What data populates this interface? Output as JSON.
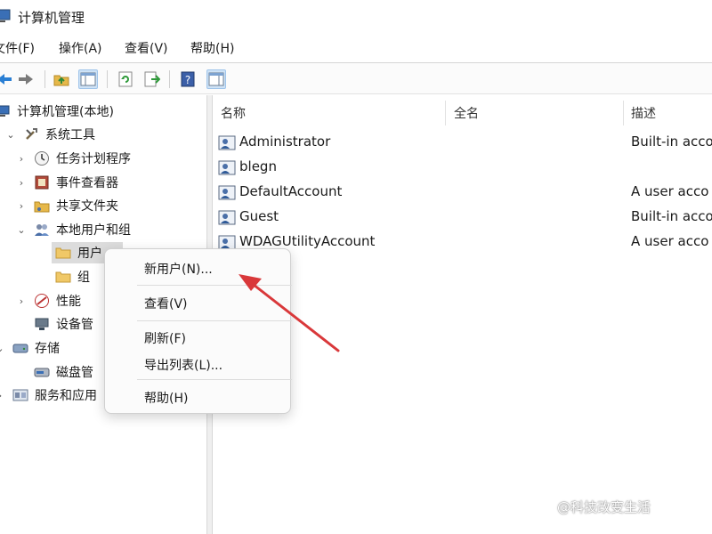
{
  "window": {
    "title": "计算机管理"
  },
  "menu": {
    "file": "文件(F)",
    "action": "操作(A)",
    "view": "查看(V)",
    "help": "帮助(H)"
  },
  "toolbar": {
    "icons": [
      "back-icon",
      "forward-icon",
      "up-folder-icon",
      "show-tree-icon",
      "refresh-icon",
      "export-icon",
      "help-icon",
      "action-pane-icon"
    ]
  },
  "tree": {
    "root": "计算机管理(本地)",
    "system_tools": "系统工具",
    "task_scheduler": "任务计划程序",
    "event_viewer": "事件查看器",
    "shared_folders": "共享文件夹",
    "local_users_groups": "本地用户和组",
    "users": "用户",
    "groups": "组",
    "performance": "性能",
    "device_manager": "设备管",
    "storage": "存储",
    "disk_management": "磁盘管",
    "services_apps": "服务和应用"
  },
  "list": {
    "columns": {
      "name": "名称",
      "fullname": "全名",
      "description": "描述"
    },
    "rows": [
      {
        "name": "Administrator",
        "fullname": "",
        "description": "Built-in acco"
      },
      {
        "name": "blegn",
        "fullname": "",
        "description": ""
      },
      {
        "name": "DefaultAccount",
        "fullname": "",
        "description": "A user acco"
      },
      {
        "name": "Guest",
        "fullname": "",
        "description": "Built-in acco"
      },
      {
        "name": "WDAGUtilityAccount",
        "fullname": "",
        "description": "A user acco"
      }
    ]
  },
  "context_menu": {
    "new_user": "新用户(N)...",
    "view": "查看(V)",
    "refresh": "刷新(F)",
    "export_list": "导出列表(L)...",
    "help": "帮助(H)"
  },
  "watermark": "@科技改变生活",
  "colors": {
    "arrow": "#d9383a",
    "selection": "#dcdcdc"
  }
}
